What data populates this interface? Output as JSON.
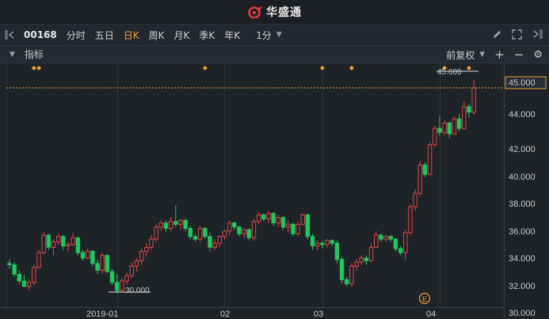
{
  "app": {
    "brand": "华盛通"
  },
  "toolbar": {
    "stock_code": "00168",
    "periods": [
      {
        "label": "分时",
        "active": false
      },
      {
        "label": "五日",
        "active": false
      },
      {
        "label": "日K",
        "active": true
      },
      {
        "label": "周K",
        "active": false
      },
      {
        "label": "月K",
        "active": false
      },
      {
        "label": "季K",
        "active": false
      },
      {
        "label": "年K",
        "active": false
      }
    ],
    "interval": "1分"
  },
  "indicator_bar": {
    "label": "指标",
    "adjust": "前复权"
  },
  "colors": {
    "up": "#e04848",
    "down": "#22c55e",
    "accent": "#f0a23a",
    "background": "#1e2328"
  },
  "chart_data": {
    "type": "candlestick",
    "y_ticks": [
      "45.000",
      "44.000",
      "42.000",
      "40.000",
      "38.000",
      "36.000",
      "34.000",
      "32.000",
      "30.000"
    ],
    "x_ticks": [
      "2019-01",
      "02",
      "03",
      "04"
    ],
    "ylim": [
      29.3,
      46.7
    ],
    "current_price": "45.000",
    "max_label": "45.600",
    "min_label": "30.000",
    "event_marker": "E",
    "candles": [
      [
        32.0,
        32.3,
        31.6,
        31.9
      ],
      [
        31.9,
        32.1,
        31.0,
        31.2
      ],
      [
        31.2,
        31.5,
        30.5,
        30.7
      ],
      [
        30.7,
        31.2,
        30.3,
        30.3
      ],
      [
        30.3,
        30.8,
        30.0,
        30.6
      ],
      [
        30.6,
        31.9,
        30.4,
        31.7
      ],
      [
        31.7,
        33.0,
        31.6,
        32.8
      ],
      [
        32.8,
        34.3,
        32.7,
        34.1
      ],
      [
        34.1,
        34.2,
        33.0,
        33.2
      ],
      [
        33.2,
        33.8,
        32.6,
        33.6
      ],
      [
        33.6,
        34.2,
        33.4,
        34.0
      ],
      [
        34.0,
        34.1,
        33.0,
        33.3
      ],
      [
        33.3,
        33.6,
        32.9,
        33.4
      ],
      [
        33.4,
        34.3,
        33.3,
        33.9
      ],
      [
        33.9,
        34.0,
        32.6,
        32.8
      ],
      [
        32.8,
        33.0,
        32.2,
        32.4
      ],
      [
        32.4,
        33.1,
        32.3,
        32.9
      ],
      [
        32.9,
        33.0,
        31.8,
        32.0
      ],
      [
        32.0,
        32.3,
        31.2,
        31.5
      ],
      [
        31.5,
        32.8,
        31.3,
        32.6
      ],
      [
        32.6,
        32.7,
        31.3,
        31.4
      ],
      [
        31.4,
        31.6,
        30.4,
        30.6
      ],
      [
        30.6,
        31.2,
        29.9,
        30.0
      ],
      [
        30.0,
        30.9,
        29.9,
        30.7
      ],
      [
        30.7,
        31.3,
        30.4,
        31.1
      ],
      [
        31.1,
        32.1,
        30.9,
        31.8
      ],
      [
        31.8,
        32.4,
        31.4,
        32.2
      ],
      [
        32.2,
        33.1,
        31.9,
        32.9
      ],
      [
        32.9,
        33.5,
        32.5,
        33.2
      ],
      [
        33.2,
        34.1,
        33.0,
        33.8
      ],
      [
        33.8,
        34.9,
        33.6,
        34.7
      ],
      [
        34.7,
        35.2,
        34.4,
        35.0
      ],
      [
        35.0,
        35.2,
        34.3,
        34.6
      ],
      [
        34.6,
        35.4,
        34.4,
        35.1
      ],
      [
        35.1,
        36.3,
        34.7,
        34.9
      ],
      [
        34.9,
        35.3,
        34.5,
        35.2
      ],
      [
        35.2,
        35.3,
        34.4,
        34.6
      ],
      [
        34.6,
        34.8,
        33.8,
        34.0
      ],
      [
        34.0,
        34.2,
        33.6,
        33.8
      ],
      [
        33.8,
        34.8,
        33.6,
        34.6
      ],
      [
        34.6,
        34.7,
        33.8,
        34.0
      ],
      [
        34.0,
        34.3,
        32.9,
        33.2
      ],
      [
        33.2,
        33.8,
        33.0,
        33.5
      ],
      [
        33.5,
        34.1,
        33.2,
        34.0
      ],
      [
        34.0,
        34.5,
        33.8,
        34.4
      ],
      [
        34.4,
        35.2,
        34.1,
        35.0
      ],
      [
        35.0,
        35.1,
        34.5,
        34.7
      ],
      [
        34.7,
        34.8,
        34.0,
        34.2
      ],
      [
        34.2,
        34.6,
        33.9,
        34.5
      ],
      [
        34.5,
        34.6,
        33.7,
        33.9
      ],
      [
        33.9,
        35.3,
        33.7,
        35.1
      ],
      [
        35.1,
        35.8,
        34.9,
        35.6
      ],
      [
        35.6,
        35.7,
        35.1,
        35.3
      ],
      [
        35.3,
        35.9,
        35.0,
        35.7
      ],
      [
        35.7,
        35.8,
        34.8,
        35.0
      ],
      [
        35.0,
        35.6,
        34.7,
        35.4
      ],
      [
        35.4,
        35.5,
        34.5,
        34.7
      ],
      [
        34.7,
        35.2,
        34.3,
        34.9
      ],
      [
        34.9,
        35.0,
        34.0,
        34.2
      ],
      [
        34.2,
        35.1,
        34.0,
        34.9
      ],
      [
        34.9,
        35.7,
        34.8,
        35.6
      ],
      [
        35.6,
        35.7,
        33.8,
        34.0
      ],
      [
        34.0,
        34.2,
        33.0,
        33.3
      ],
      [
        33.3,
        33.7,
        33.0,
        33.5
      ],
      [
        33.5,
        33.7,
        33.1,
        33.4
      ],
      [
        33.4,
        33.8,
        33.2,
        33.7
      ],
      [
        33.7,
        33.8,
        33.3,
        33.5
      ],
      [
        33.5,
        33.7,
        32.0,
        32.3
      ],
      [
        32.3,
        32.5,
        30.5,
        30.8
      ],
      [
        30.8,
        31.0,
        30.3,
        30.5
      ],
      [
        30.5,
        32.0,
        30.3,
        31.8
      ],
      [
        31.8,
        32.3,
        31.5,
        32.1
      ],
      [
        32.1,
        32.6,
        31.9,
        32.4
      ],
      [
        32.4,
        32.6,
        31.9,
        32.2
      ],
      [
        32.2,
        33.5,
        32.1,
        33.2
      ],
      [
        33.2,
        34.4,
        33.1,
        34.1
      ],
      [
        34.1,
        34.2,
        33.6,
        33.8
      ],
      [
        33.8,
        34.1,
        33.6,
        34.0
      ],
      [
        34.0,
        34.1,
        33.6,
        33.8
      ],
      [
        33.8,
        33.9,
        32.9,
        33.1
      ],
      [
        33.1,
        33.3,
        32.6,
        32.8
      ],
      [
        32.8,
        34.5,
        32.2,
        34.3
      ],
      [
        34.3,
        36.4,
        34.1,
        36.2
      ],
      [
        36.2,
        37.5,
        35.9,
        37.2
      ],
      [
        37.2,
        39.6,
        37.0,
        39.3
      ],
      [
        39.3,
        39.5,
        38.4,
        38.6
      ],
      [
        38.6,
        41.0,
        38.5,
        40.8
      ],
      [
        40.8,
        42.2,
        40.6,
        42.0
      ],
      [
        42.0,
        42.9,
        41.4,
        41.7
      ],
      [
        41.7,
        42.6,
        41.5,
        42.4
      ],
      [
        42.4,
        42.5,
        41.3,
        41.6
      ],
      [
        41.6,
        42.9,
        41.5,
        42.7
      ],
      [
        42.7,
        43.1,
        41.8,
        42.0
      ],
      [
        42.0,
        44.0,
        41.9,
        43.6
      ],
      [
        43.6,
        43.8,
        42.8,
        43.2
      ],
      [
        43.2,
        45.6,
        43.0,
        45.0
      ]
    ],
    "diamonds": [
      5,
      6,
      40,
      64,
      70,
      89,
      94
    ],
    "month_starts": [
      22,
      44,
      64,
      88
    ]
  }
}
